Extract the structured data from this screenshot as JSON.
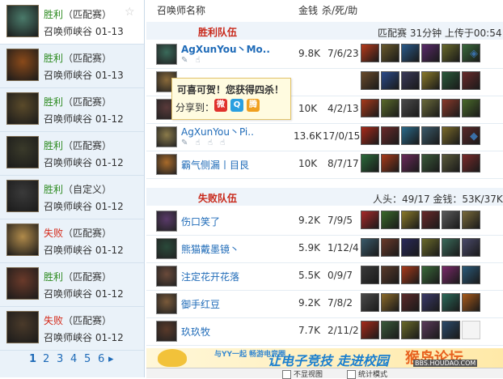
{
  "history": [
    {
      "result": "胜利",
      "result_type": "win",
      "mode": "（匹配赛）",
      "map": "召唤师峡谷",
      "date": "01-13",
      "selected": true,
      "avatar_color": "#4a7a6a"
    },
    {
      "result": "胜利",
      "result_type": "win",
      "mode": "（匹配赛）",
      "map": "召唤师峡谷",
      "date": "01-13",
      "selected": false,
      "avatar_color": "#8a4a1a"
    },
    {
      "result": "胜利",
      "result_type": "win",
      "mode": "（匹配赛）",
      "map": "召唤师峡谷",
      "date": "01-12",
      "selected": false,
      "avatar_color": "#5a4a2a"
    },
    {
      "result": "胜利",
      "result_type": "win",
      "mode": "（匹配赛）",
      "map": "召唤师峡谷",
      "date": "01-12",
      "selected": false,
      "avatar_color": "#3a3a2a"
    },
    {
      "result": "胜利",
      "result_type": "win",
      "mode": "（自定义）",
      "map": "召唤师峡谷",
      "date": "01-12",
      "selected": false,
      "avatar_color": "#3a3a3a"
    },
    {
      "result": "失败",
      "result_type": "lose",
      "mode": "（匹配赛）",
      "map": "召唤师峡谷",
      "date": "01-12",
      "selected": false,
      "avatar_color": "#b08a4a"
    },
    {
      "result": "胜利",
      "result_type": "win",
      "mode": "（匹配赛）",
      "map": "召唤师峡谷",
      "date": "01-12",
      "selected": false,
      "avatar_color": "#6a3a2a"
    },
    {
      "result": "失败",
      "result_type": "lose",
      "mode": "（匹配赛）",
      "map": "召唤师峡谷",
      "date": "01-12",
      "selected": false,
      "avatar_color": "#4a3a2a"
    }
  ],
  "pager": {
    "pages": [
      "1",
      "2",
      "3",
      "4",
      "5",
      "6"
    ],
    "current": "1",
    "next": "▸"
  },
  "header": {
    "name_col": "召唤师名称",
    "gold_col": "金钱",
    "kda_col": "杀/死/助"
  },
  "win_team": {
    "title": "胜利队伍",
    "meta": "匹配赛 31分钟 上传于00:54"
  },
  "lose_team": {
    "title": "失败队伍",
    "meta": "人头：49/17 金钱：53K/37K"
  },
  "win_players": [
    {
      "name": "AgXunYou丶Mo..",
      "bold": true,
      "icons": "✎ ☝",
      "gold": "9.8K",
      "kda": "7/6/23",
      "avatar_color": "#3a6a5a",
      "items": [
        "#b83a1a",
        "#6a5a2a",
        "#2a5a8a",
        "#5a2a6a",
        "#6a6a2a",
        "#3a6a3a"
      ],
      "trinket": "◈"
    },
    {
      "name": "",
      "bold": false,
      "icons": "",
      "gold": "",
      "kda": "",
      "avatar_color": "#8a6a3a",
      "items": [
        "#6a4a2a",
        "#2a4a8a",
        "#3a3a5a",
        "#8a7a2a",
        "#2a5a3a",
        "#6a2a2a"
      ],
      "trinket": ""
    },
    {
      "name": "分享到",
      "bold": false,
      "icons": "✎",
      "gold": "10K",
      "kda": "4/2/13",
      "avatar_color": "#5a3a3a",
      "items": [
        "#a83a1a",
        "#5a6a2a",
        "#4a4a4a",
        "#6a6a3a",
        "#8a3a2a",
        "#4a6a2a"
      ],
      "trinket": ""
    },
    {
      "name": "AgXunYou丶Pi..",
      "bold": false,
      "icons": "✎ ☝ ☝ ☝",
      "gold": "13.6K",
      "kda": "17/0/15",
      "avatar_color": "#8a7a4a",
      "items": [
        "#a82a1a",
        "#6a2a2a",
        "#2a6a8a",
        "#3a5a6a",
        "#7a6a2a",
        "#5a2a2a"
      ],
      "trinket": "◆"
    },
    {
      "name": "霸气侧漏丨目艮",
      "bold": false,
      "icons": "",
      "gold": "10K",
      "kda": "8/7/17",
      "avatar_color": "#a86a2a",
      "items": [
        "#2a6a3a",
        "#a83a1a",
        "#6a2a5a",
        "#3a5a3a",
        "#5a5a3a",
        "#7a2a2a"
      ],
      "trinket": ""
    }
  ],
  "lose_players": [
    {
      "name": "伤口笑了",
      "bold": false,
      "icons": "",
      "gold": "9.2K",
      "kda": "7/9/5",
      "avatar_color": "#5a3a6a",
      "items": [
        "#a82a2a",
        "#3a6a2a",
        "#8a7a2a",
        "#6a2a2a",
        "#5a5a5a",
        "#7a6a3a"
      ],
      "trinket": ""
    },
    {
      "name": "熊猫戴墨镜丶",
      "bold": false,
      "icons": "",
      "gold": "5.9K",
      "kda": "1/12/4",
      "avatar_color": "#2a4a3a",
      "items": [
        "#3a5a6a",
        "#6a3a2a",
        "#2a2a5a",
        "#6a6a2a",
        "#3a6a5a",
        "#4a4a6a"
      ],
      "trinket": ""
    },
    {
      "name": "注定花开花落",
      "bold": false,
      "icons": "",
      "gold": "5.5K",
      "kda": "0/9/7",
      "avatar_color": "#6a4a3a",
      "items": [
        "#3a3a3a",
        "#5a3a2a",
        "#a83a1a",
        "#3a6a3a",
        "#7a2a6a",
        "#2a5a7a"
      ],
      "trinket": ""
    },
    {
      "name": "御手红豆",
      "bold": false,
      "icons": "",
      "gold": "9.2K",
      "kda": "7/8/2",
      "avatar_color": "#7a5a3a",
      "items": [
        "#4a4a4a",
        "#8a6a2a",
        "#5a2a2a",
        "#3a3a6a",
        "#2a6a5a",
        "#a85a1a"
      ],
      "trinket": ""
    },
    {
      "name": "玖玖牧",
      "bold": false,
      "icons": "",
      "gold": "7.7K",
      "kda": "2/11/2",
      "avatar_color": "#5a3a2a",
      "items": [
        "#a82a1a",
        "#3a5a3a",
        "#6a6a2a",
        "#5a3a5a",
        "#2a4a6a",
        ""
      ],
      "trinket": ""
    }
  ],
  "tooltip": {
    "title": "可喜可贺！您获得四杀！",
    "share_label": "分享到：",
    "share_icons": [
      {
        "name": "weibo",
        "glyph": "微",
        "color": "#e0322d"
      },
      {
        "name": "qzone",
        "glyph": "Q",
        "color": "#2a9fe0"
      },
      {
        "name": "tencent",
        "glyph": "腾",
        "color": "#f0a020"
      }
    ]
  },
  "banner": {
    "small": "与YY一起 畅游电竞圈",
    "text": "让电子竞技 走进校园",
    "watermark": "猴岛论坛",
    "url": "BBS.HOUDAO.COM"
  },
  "footer": {
    "opt1": "不显视图",
    "opt2": "统计模式"
  }
}
